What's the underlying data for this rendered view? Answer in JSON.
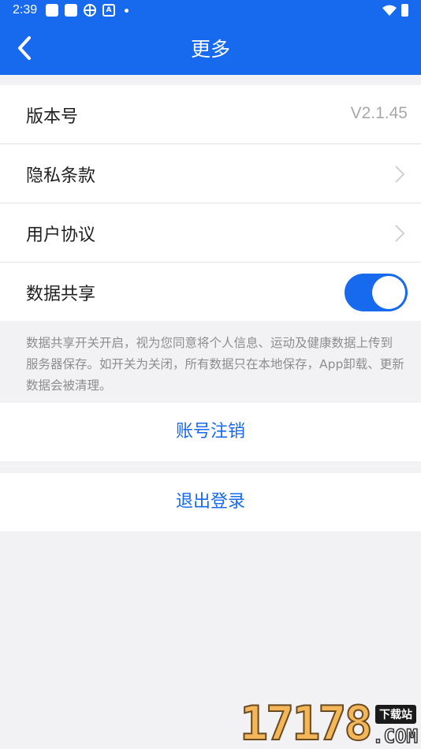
{
  "status_bar": {
    "time": "2:39",
    "icons": [
      "notification-square-icon",
      "notification-square-icon",
      "pinwheel-icon",
      "a-box-icon",
      "dot-icon",
      "wifi-icon",
      "battery-icon"
    ],
    "a_box_label": "A"
  },
  "header": {
    "title": "更多",
    "back_icon": "chevron-left-icon",
    "background_color": "#1769ee"
  },
  "settings": {
    "version": {
      "label": "版本号",
      "value": "V2.1.45"
    },
    "privacy": {
      "label": "隐私条款",
      "icon": "chevron-right-icon"
    },
    "agreement": {
      "label": "用户协议",
      "icon": "chevron-right-icon"
    },
    "data_sharing": {
      "label": "数据共享",
      "enabled": true,
      "accent_color": "#1769ee"
    }
  },
  "note": "数据共享开关开启，视为您同意将个人信息、运动及健康数据上传到服务器保存。如开关为关闭，所有数据只在本地保存，App卸载、更新数据会被清理。",
  "actions": {
    "cancel_account": "账号注销",
    "logout": "退出登录"
  },
  "watermark": {
    "number": "17178",
    "badge": "下载站",
    "domain": ".COM"
  }
}
